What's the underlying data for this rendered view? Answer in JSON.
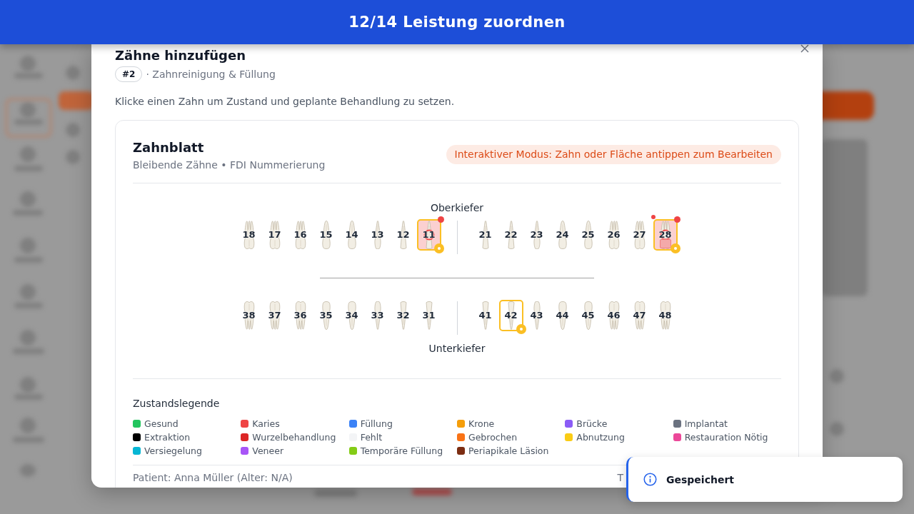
{
  "header": {
    "title": "12/14 Leistung zuordnen"
  },
  "dialog": {
    "title": "Zähne hinzufügen",
    "badge": "#2",
    "service": "· Zahnreinigung & Füllung",
    "instruction": "Klicke einen Zahn um Zustand und geplante Behandlung zu setzen.",
    "chart": {
      "title": "Zahnblatt",
      "subtitle": "Bleibende Zähne • FDI Nummerierung",
      "mode_hint": "Interaktiver Modus: Zahn oder Fläche antippen zum Bearbeiten",
      "upper_jaw": {
        "label": "Oberkiefer",
        "left": [
          {
            "number": "18",
            "kind": "molar",
            "selected": false,
            "planned": false,
            "flagged": false,
            "surface_marked": false
          },
          {
            "number": "17",
            "kind": "molar",
            "selected": false,
            "planned": false,
            "flagged": false,
            "surface_marked": false
          },
          {
            "number": "16",
            "kind": "molar",
            "selected": false,
            "planned": false,
            "flagged": false,
            "surface_marked": false
          },
          {
            "number": "15",
            "kind": "premolar",
            "selected": false,
            "planned": false,
            "flagged": false,
            "surface_marked": false
          },
          {
            "number": "14",
            "kind": "premolar",
            "selected": false,
            "planned": false,
            "flagged": false,
            "surface_marked": false
          },
          {
            "number": "13",
            "kind": "canine",
            "selected": false,
            "planned": false,
            "flagged": false,
            "surface_marked": false
          },
          {
            "number": "12",
            "kind": "incisor",
            "selected": false,
            "planned": false,
            "flagged": false,
            "surface_marked": false
          },
          {
            "number": "11",
            "kind": "incisor",
            "selected": true,
            "planned": true,
            "flagged": false,
            "surface_marked": false,
            "color": "#ef4444"
          }
        ],
        "right": [
          {
            "number": "21",
            "kind": "incisor",
            "selected": false,
            "planned": false,
            "flagged": false,
            "surface_marked": false
          },
          {
            "number": "22",
            "kind": "incisor",
            "selected": false,
            "planned": false,
            "flagged": false,
            "surface_marked": false
          },
          {
            "number": "23",
            "kind": "canine",
            "selected": false,
            "planned": false,
            "flagged": false,
            "surface_marked": false
          },
          {
            "number": "24",
            "kind": "premolar",
            "selected": false,
            "planned": false,
            "flagged": false,
            "surface_marked": false
          },
          {
            "number": "25",
            "kind": "premolar",
            "selected": false,
            "planned": false,
            "flagged": false,
            "surface_marked": false
          },
          {
            "number": "26",
            "kind": "molar",
            "selected": false,
            "planned": false,
            "flagged": false,
            "surface_marked": false
          },
          {
            "number": "27",
            "kind": "molar",
            "selected": false,
            "planned": false,
            "flagged": false,
            "surface_marked": false
          },
          {
            "number": "28",
            "kind": "molar",
            "selected": true,
            "planned": true,
            "flagged": true,
            "surface_marked": true,
            "color": "#ef4444"
          }
        ]
      },
      "lower_jaw": {
        "label": "Unterkiefer",
        "left": [
          {
            "number": "38",
            "kind": "molar",
            "selected": false,
            "planned": false,
            "flagged": false,
            "surface_marked": false
          },
          {
            "number": "37",
            "kind": "molar",
            "selected": false,
            "planned": false,
            "flagged": false,
            "surface_marked": false
          },
          {
            "number": "36",
            "kind": "molar",
            "selected": false,
            "planned": false,
            "flagged": false,
            "surface_marked": false
          },
          {
            "number": "35",
            "kind": "premolar",
            "selected": false,
            "planned": false,
            "flagged": false,
            "surface_marked": false
          },
          {
            "number": "34",
            "kind": "premolar",
            "selected": false,
            "planned": false,
            "flagged": false,
            "surface_marked": false
          },
          {
            "number": "33",
            "kind": "canine",
            "selected": false,
            "planned": false,
            "flagged": false,
            "surface_marked": false
          },
          {
            "number": "32",
            "kind": "incisor",
            "selected": false,
            "planned": false,
            "flagged": false,
            "surface_marked": false
          },
          {
            "number": "31",
            "kind": "incisor",
            "selected": false,
            "planned": false,
            "flagged": false,
            "surface_marked": false
          }
        ],
        "right": [
          {
            "number": "41",
            "kind": "incisor",
            "selected": false,
            "planned": false,
            "flagged": false,
            "surface_marked": false
          },
          {
            "number": "42",
            "kind": "incisor",
            "selected": true,
            "planned": true,
            "flagged": false,
            "surface_marked": false
          },
          {
            "number": "43",
            "kind": "canine",
            "selected": false,
            "planned": false,
            "flagged": false,
            "surface_marked": false
          },
          {
            "number": "44",
            "kind": "premolar",
            "selected": false,
            "planned": false,
            "flagged": false,
            "surface_marked": false
          },
          {
            "number": "45",
            "kind": "premolar",
            "selected": false,
            "planned": false,
            "flagged": false,
            "surface_marked": false
          },
          {
            "number": "46",
            "kind": "molar",
            "selected": false,
            "planned": false,
            "flagged": false,
            "surface_marked": false
          },
          {
            "number": "47",
            "kind": "molar",
            "selected": false,
            "planned": false,
            "flagged": false,
            "surface_marked": false
          },
          {
            "number": "48",
            "kind": "molar",
            "selected": false,
            "planned": false,
            "flagged": false,
            "surface_marked": false
          }
        ]
      },
      "legend": {
        "title": "Zustandslegende",
        "items": [
          {
            "label": "Gesund",
            "color": "#22c55e"
          },
          {
            "label": "Karies",
            "color": "#ef4444"
          },
          {
            "label": "Füllung",
            "color": "#3b82f6"
          },
          {
            "label": "Krone",
            "color": "#f59e0b"
          },
          {
            "label": "Brücke",
            "color": "#8b5cf6"
          },
          {
            "label": "Implantat",
            "color": "#6b7280"
          },
          {
            "label": "Extraktion",
            "color": "#000000"
          },
          {
            "label": "Wurzelbehandlung",
            "color": "#dc2626"
          },
          {
            "label": "Fehlt",
            "color": "#f3f4f6"
          },
          {
            "label": "Gebrochen",
            "color": "#f97316"
          },
          {
            "label": "Abnutzung",
            "color": "#facc15"
          },
          {
            "label": "Restauration Nötig",
            "color": "#ec4899"
          },
          {
            "label": "Versiegelung",
            "color": "#06b6d4"
          },
          {
            "label": "Veneer",
            "color": "#a855f7"
          },
          {
            "label": "Temporäre Füllung",
            "color": "#84cc16"
          },
          {
            "label": "Periapikale Läsion",
            "color": "#7c2d12"
          }
        ]
      },
      "footer": {
        "patient": "Patient: Anna Müller (Alter: N/A)",
        "right_text": "T"
      }
    }
  },
  "toast": {
    "message": "Gespeichert"
  }
}
